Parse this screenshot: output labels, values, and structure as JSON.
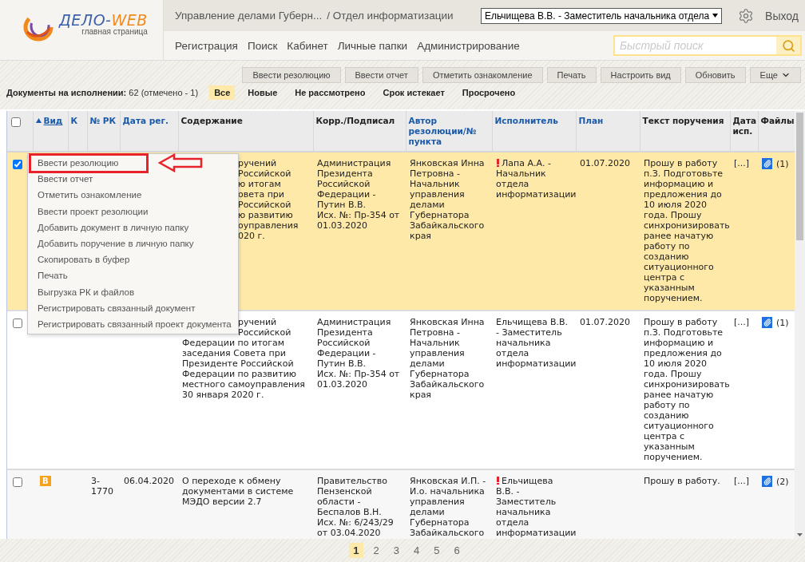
{
  "header": {
    "logo": {
      "title_main": "ДЕЛО-",
      "title_accent": "WEB",
      "subtitle": "главная страница"
    },
    "org": "Управление делами Губерн...",
    "department": "/ Отдел информатизации",
    "user_select": {
      "value": "Ельчищева В.В. - Заместитель начальника отдела"
    },
    "logout": "Выход",
    "nav": [
      "Регистрация",
      "Поиск",
      "Кабинет",
      "Личные папки",
      "Администрирование"
    ],
    "search": {
      "placeholder": "Быстрый поиск"
    }
  },
  "toolbar": {
    "buttons": [
      {
        "label": "Ввести резолюцию",
        "kind": "plain"
      },
      {
        "label": "Ввести отчет",
        "kind": "plain"
      },
      {
        "label": "Отметить ознакомление",
        "kind": "plain"
      },
      {
        "label": "Печать",
        "kind": "plain"
      },
      {
        "label": "Настроить вид",
        "kind": "plain"
      },
      {
        "label": "Обновить",
        "kind": "plain"
      },
      {
        "label": "Еще",
        "kind": "dropdown"
      }
    ]
  },
  "filter_bar": {
    "summary": "**Документы на исполнении:** 62 (отмечено - 1)",
    "filters": [
      {
        "label": "Все",
        "selected": true
      },
      {
        "label": "Новые",
        "selected": false
      },
      {
        "label": "Не рассмотрено",
        "selected": false
      },
      {
        "label": "Срок истекает",
        "selected": false
      },
      {
        "label": "Просрочено",
        "selected": false
      }
    ]
  },
  "table": {
    "select_all": {
      "checked": false
    },
    "columns": [
      {
        "label": "Вид",
        "sortable": true,
        "sorted": true
      },
      {
        "label": "К",
        "sortable": true,
        "sorted": false
      },
      {
        "label": "№ РК",
        "sortable": true,
        "sorted": false
      },
      {
        "label": "Дата рег.",
        "sortable": true,
        "sorted": false
      },
      {
        "label": "Содержание",
        "sortable": false,
        "sorted": false
      },
      {
        "label": "Корр./Подписал",
        "sortable": false,
        "sorted": false
      },
      {
        "label": "Автор резолюции/№ пункта",
        "sortable": true,
        "sorted": false
      },
      {
        "label": "Исполнитель",
        "sortable": true,
        "sorted": false
      },
      {
        "label": "План",
        "sortable": true,
        "sorted": false
      },
      {
        "label": "Текст поручения",
        "sortable": false,
        "sorted": false
      },
      {
        "label": "Дата исп.",
        "sortable": false,
        "sorted": false
      },
      {
        "label": "Файлы",
        "sortable": false,
        "sorted": false
      }
    ],
    "rows": [
      {
        "checked": true,
        "content_lines": [
          {
            "text": "ручений",
            "cut": true
          },
          {
            "text": "Российской",
            "cut": true
          },
          {
            "text": "ю итогам",
            "cut": true
          },
          {
            "text": "овета при",
            "cut": true
          },
          {
            "text": "Российской",
            "cut": true
          },
          {
            "text": "ю развитию",
            "cut": true
          },
          {
            "text": "оуправления",
            "cut": true
          },
          {
            "text": "020 г.",
            "cut": true
          }
        ],
        "signer": "Администрация Президента Российской Федерации - Путин В.В.",
        "out_ref": "Исх. №: Пр-354 от 01.03.2020",
        "author": "Янковская Инна Петровна - Начальник управления делами Губернатора Забайкальского края",
        "executor": {
          "text": "Лапа А.А. - Начальник отдела информатизации",
          "urgent": true
        },
        "plan": "01.07.2020",
        "instruction": "Прошу в работу п.З. Подготовьте информацию и предложения до 10 июля 2020 года. Прошу синхронизировать ранее начатую работу по созданию ситуационного центра с указанным поручением.",
        "exec_date": "[...]",
        "files": "(1)"
      },
      {
        "checked": false,
        "content_lines": [
          {
            "text": "ручений",
            "cut": true
          },
          {
            "text": "Российской",
            "cut": true
          },
          {
            "text": "Федерации по итогам",
            "cut": false
          },
          {
            "text": "заседания Совета при",
            "cut": false
          },
          {
            "text": "Президенте Российской",
            "cut": false
          },
          {
            "text": "Федерации по развитию",
            "cut": false
          },
          {
            "text": "местного самоуправления",
            "cut": false
          },
          {
            "text": "30 января 2020 г.",
            "cut": false
          }
        ],
        "signer": "Администрация Президента Российской Федерации - Путин В.В.",
        "out_ref": "Исх. №: Пр-354 от 01.03.2020",
        "author": "Янковская Инна Петровна - Начальник управления делами Губернатора Забайкальского края",
        "executor": {
          "text": "Ельчищева В.В. - Заместитель начальника отдела информатизации",
          "urgent": false
        },
        "plan": "01.07.2020",
        "instruction": "Прошу в работу п.З. Подготовьте информацию и предложения до 10 июля 2020 года. Прошу синхронизировать ранее начатую работу по созданию ситуационного центра с указанным поручением.",
        "exec_date": "[...]",
        "files": "(1)"
      },
      {
        "checked": false,
        "badge": "В",
        "rk_no": "3-1770",
        "reg_date": "06.04.2020",
        "content_lines": [
          {
            "text": "О переходе к обмену",
            "cut": false
          },
          {
            "text": "документами в системе",
            "cut": false
          },
          {
            "text": "МЭДО версии 2.7",
            "cut": false
          }
        ],
        "signer": "Правительство Пензенской области - Беспалов В.Н.",
        "out_ref": "Исх. №: 6/243/29 от 03.04.2020",
        "author": "Янковская И.П. - И.о. начальника управления делами Губернатора Забайкальского",
        "executor": {
          "text": "Ельчищева В.В. - Заместитель начальника отдела информатизации",
          "urgent": true
        },
        "instruction": "Прошу в работу.",
        "exec_date": "[...]",
        "files": "(2)"
      }
    ]
  },
  "context_menu": {
    "items": [
      {
        "label": "Ввести резолюцию",
        "selected": true
      },
      {
        "label": "Ввести отчет",
        "selected": false
      },
      {
        "label": "Отметить ознакомление",
        "selected": false
      },
      {
        "label": "Ввести проект резолюции",
        "selected": false
      },
      {
        "label": "Добавить документ в личную папку",
        "selected": false
      },
      {
        "label": "Добавить поручение в личную папку",
        "selected": false
      },
      {
        "label": "Скопировать в буфер",
        "selected": false
      },
      {
        "label": "Печать",
        "selected": false
      },
      {
        "label": "Выгрузка РК и файлов",
        "selected": false
      },
      {
        "label": "Регистрировать связанный документ",
        "selected": false
      },
      {
        "label": "Регистрировать связанный проект документа",
        "selected": false
      }
    ]
  },
  "pagination": [
    {
      "label": "1",
      "selected": true
    },
    {
      "label": "2",
      "selected": false
    },
    {
      "label": "3",
      "selected": false
    },
    {
      "label": "4",
      "selected": false
    },
    {
      "label": "5",
      "selected": false
    },
    {
      "label": "6",
      "selected": false
    }
  ]
}
